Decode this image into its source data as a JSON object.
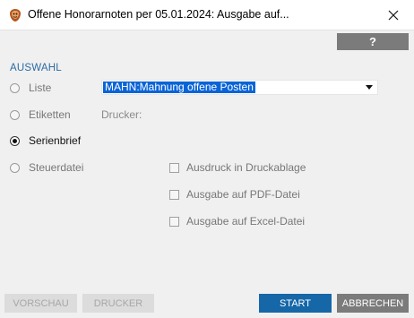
{
  "window": {
    "title": "Offene Honorarnoten per 05.01.2024: Ausgabe auf...",
    "close_glyph": "✕"
  },
  "toolbar": {
    "help_label": "?"
  },
  "auswahl": {
    "section_label": "AUSWAHL",
    "options": [
      {
        "label": "Liste",
        "checked": false
      },
      {
        "label": "Etiketten",
        "checked": false
      },
      {
        "label": "Serienbrief",
        "checked": true
      },
      {
        "label": "Steuerdatei",
        "checked": false
      }
    ],
    "report_select": {
      "value": "MAHN:Mahnung offene Posten"
    },
    "printer_label": "Drucker:",
    "checkboxes": [
      {
        "label": "Ausdruck in Druckablage",
        "checked": false
      },
      {
        "label": "Ausgabe auf PDF-Datei",
        "checked": false
      },
      {
        "label": "Ausgabe auf Excel-Datei",
        "checked": false
      }
    ]
  },
  "footer": {
    "preview_label": "VORSCHAU",
    "printer_label": "DRUCKER",
    "start_label": "START",
    "cancel_label": "ABBRECHEN"
  },
  "colors": {
    "accent": "#1667a8",
    "section_label": "#2b6ca3",
    "selection": "#0a64d6",
    "neutral_button": "#7b7b7b"
  }
}
